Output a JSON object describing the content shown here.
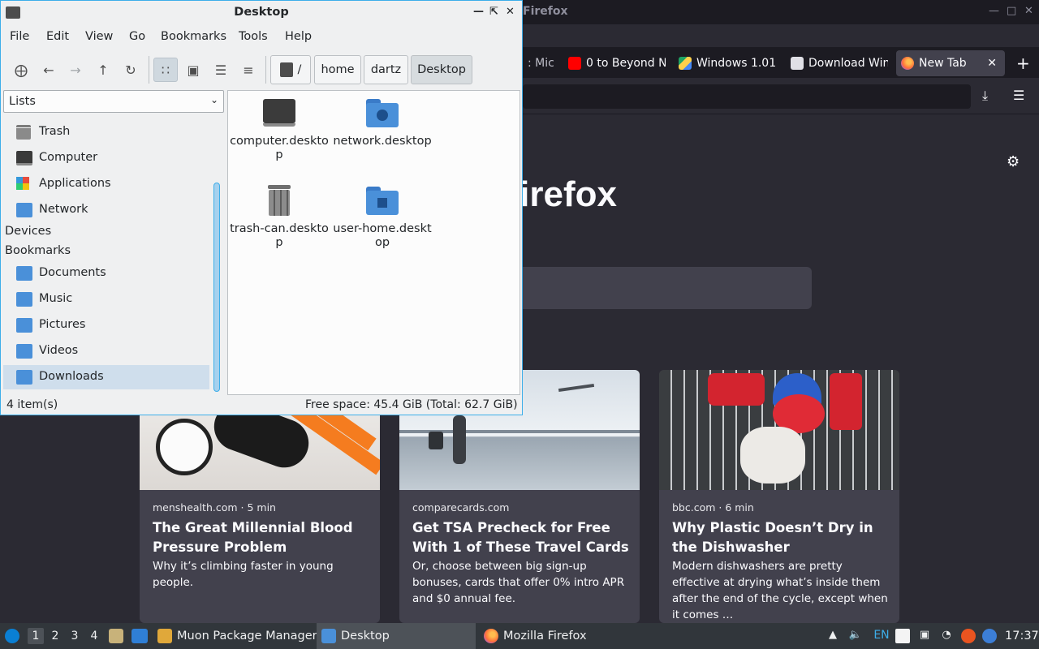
{
  "firefox": {
    "window_title": "Firefox",
    "tabs": [
      {
        "label": ": Mic",
        "color": "#2b2a33"
      },
      {
        "label": "0 to Beyond N",
        "color": "#ff0000"
      },
      {
        "label": "Windows 1.01",
        "color": "#1fa463"
      },
      {
        "label": "Download Win",
        "color": "#e0e0e6"
      },
      {
        "label": "New Tab",
        "color": "#ff7139"
      }
    ],
    "logo_text": "irefox",
    "cards": [
      {
        "source": "menshealth.com · 5 min",
        "title": "The Great Millennial Blood Pressure Problem",
        "desc": "Why it’s climbing faster in young people."
      },
      {
        "source": "comparecards.com",
        "title": "Get TSA Precheck for Free With 1 of These Travel Cards",
        "desc": "Or, choose between big sign-up bonuses, cards that offer 0% intro APR and $0 annual fee."
      },
      {
        "source": "bbc.com · 6 min",
        "title": "Why Plastic Doesn’t Dry in the Dishwasher",
        "desc": "Modern dishwashers are pretty effective at drying what’s inside them after the end of the cycle, except when it comes …"
      }
    ]
  },
  "fm": {
    "title": "Desktop",
    "menu": [
      "File",
      "Edit",
      "View",
      "Go",
      "Bookmarks",
      "Tools",
      "Help"
    ],
    "breadcrumb": [
      "/",
      "home",
      "dartz",
      "Desktop"
    ],
    "combo": "Lists",
    "places": [
      "Trash",
      "Computer",
      "Applications",
      "Network"
    ],
    "devices_header": "Devices",
    "bookmarks_header": "Bookmarks",
    "bookmarks": [
      "Documents",
      "Music",
      "Pictures",
      "Videos",
      "Downloads"
    ],
    "files": [
      "computer.desktop",
      "network.desktop",
      "trash-can.desktop",
      "user-home.desktop"
    ],
    "status_left": "4 item(s)",
    "status_right": "Free space: 45.4 GiB (Total: 62.7 GiB)"
  },
  "taskbar": {
    "desktops": [
      "1",
      "2",
      "3",
      "4"
    ],
    "tasks": [
      "Muon Package Manager",
      "Desktop",
      "Mozilla Firefox"
    ],
    "lang": "EN",
    "clock": "17:37"
  },
  "colors": {
    "accent": "#3daee9",
    "folder": "#4a90d9",
    "panel": "#31363b"
  }
}
